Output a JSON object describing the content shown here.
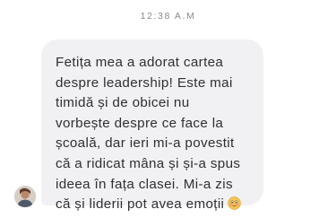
{
  "timestamp": "12:38 A.M",
  "message": {
    "lines": [
      "Fetița mea a adorat cartea",
      "despre leadership! Este mai",
      "timidă și de obicei nu",
      "vorbește despre ce face la",
      "școală, dar ieri mi-a povestit",
      "că a ridicat mâna și și-a spus",
      "ideea în fața clasei. Mi-a zis",
      "că și liderii pot avea emoții"
    ],
    "trailing_emoji": "flushed-face-emoji"
  },
  "colors": {
    "bubble": "#f1f1f3",
    "text": "#2f2f34",
    "timestamp": "#8a8a8a"
  }
}
